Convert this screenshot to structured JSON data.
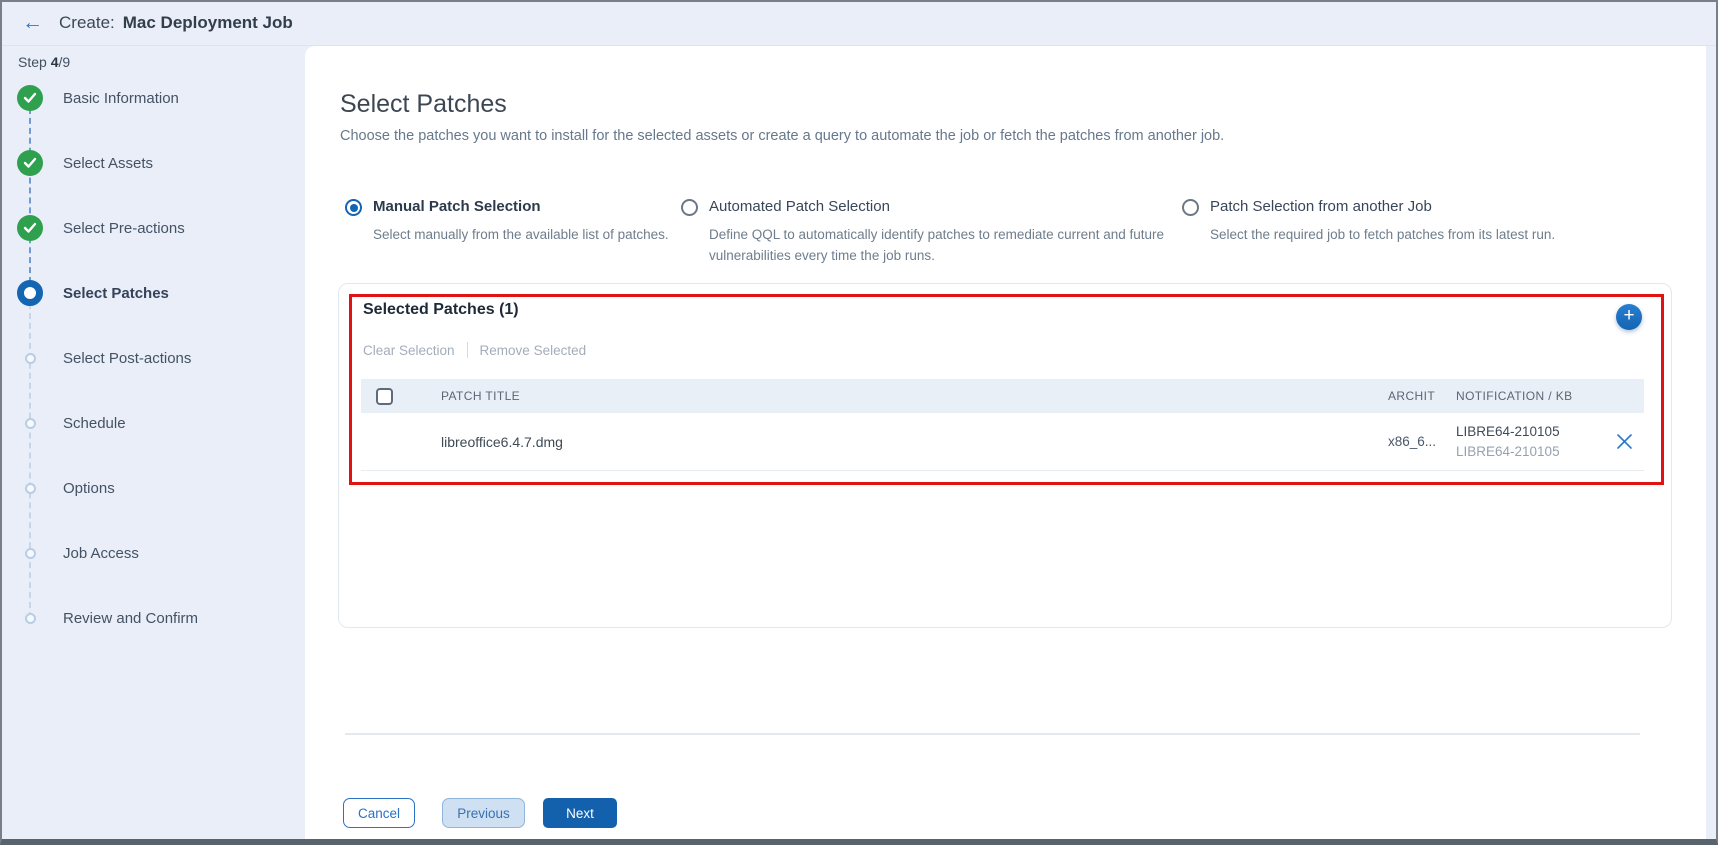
{
  "header": {
    "back_icon": "←",
    "create_label": "Create:",
    "job_title": "Mac Deployment Job"
  },
  "sidebar": {
    "step_prefix": "Step",
    "step_current": "4",
    "step_total": "/9",
    "steps": [
      {
        "label": "Basic Information",
        "status": "done"
      },
      {
        "label": "Select Assets",
        "status": "done"
      },
      {
        "label": "Select Pre-actions",
        "status": "done"
      },
      {
        "label": "Select Patches",
        "status": "current"
      },
      {
        "label": "Select Post-actions",
        "status": "todo"
      },
      {
        "label": "Schedule",
        "status": "todo"
      },
      {
        "label": "Options",
        "status": "todo"
      },
      {
        "label": "Job Access",
        "status": "todo"
      },
      {
        "label": "Review and Confirm",
        "status": "todo"
      }
    ]
  },
  "main": {
    "title": "Select Patches",
    "subtitle": "Choose the patches you want to install for the selected assets or create a query to automate the job or fetch the patches from another job.",
    "options": [
      {
        "label": "Manual Patch Selection",
        "description": "Select manually from the available list of patches.",
        "selected": true
      },
      {
        "label": "Automated Patch Selection",
        "description": "Define QQL to automatically identify patches to remediate current and future vulnerabilities every time the job runs.",
        "selected": false
      },
      {
        "label": "Patch Selection from another Job",
        "description": "Select the required job to fetch patches from its latest run.",
        "selected": false
      }
    ],
    "panel": {
      "title": "Selected Patches (1)",
      "add_icon": "+",
      "actions": [
        {
          "label": "Clear Selection"
        },
        {
          "label": "Remove Selected"
        }
      ],
      "table": {
        "columns": [
          "PATCH TITLE",
          "ARCHIT",
          "NOTIFICATION / KB"
        ],
        "rows": [
          {
            "patch_title": "libreoffice6.4.7.dmg",
            "architecture": "x86_6...",
            "notification_kb": [
              "LIBRE64-210105",
              "LIBRE64-210105"
            ]
          }
        ]
      }
    },
    "footer_buttons": [
      {
        "label": "Cancel"
      },
      {
        "label": "Previous"
      },
      {
        "label": "Next"
      }
    ]
  },
  "colors": {
    "accent_blue": "#1465b2",
    "success_green": "#2fa14e",
    "annotation_red": "#e01212",
    "page_background": "#e9eef8"
  }
}
